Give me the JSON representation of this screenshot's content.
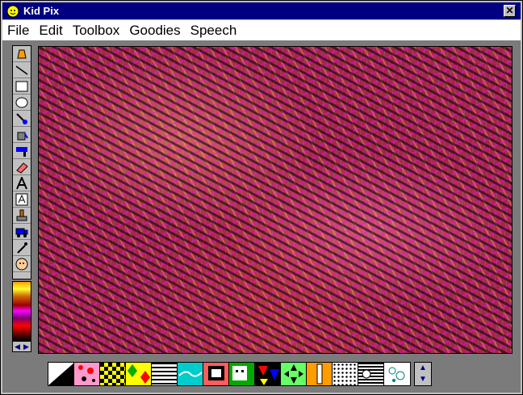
{
  "window": {
    "title": "Kid Pix",
    "close_label": "✕"
  },
  "menu": [
    "File",
    "Edit",
    "Toolbox",
    "Goodies",
    "Speech"
  ],
  "toolbox": [
    {
      "name": "pencil-icon"
    },
    {
      "name": "line-icon"
    },
    {
      "name": "rectangle-icon"
    },
    {
      "name": "oval-icon"
    },
    {
      "name": "paintbrush-icon"
    },
    {
      "name": "paint-bucket-icon"
    },
    {
      "name": "wacky-brush-icon"
    },
    {
      "name": "eraser-icon"
    },
    {
      "name": "text-icon"
    },
    {
      "name": "text-stamp-icon"
    },
    {
      "name": "rubber-stamp-icon"
    },
    {
      "name": "moving-van-icon"
    },
    {
      "name": "eyedropper-icon"
    },
    {
      "name": "undo-guy-icon"
    }
  ],
  "color_arrows": [
    "◀",
    "▶"
  ],
  "stamp_scroll": [
    "▲",
    "▼"
  ],
  "colors": {
    "titlebar": "#000080",
    "workarea": "#7b7b7b",
    "chrome": "#c0c0c0"
  }
}
